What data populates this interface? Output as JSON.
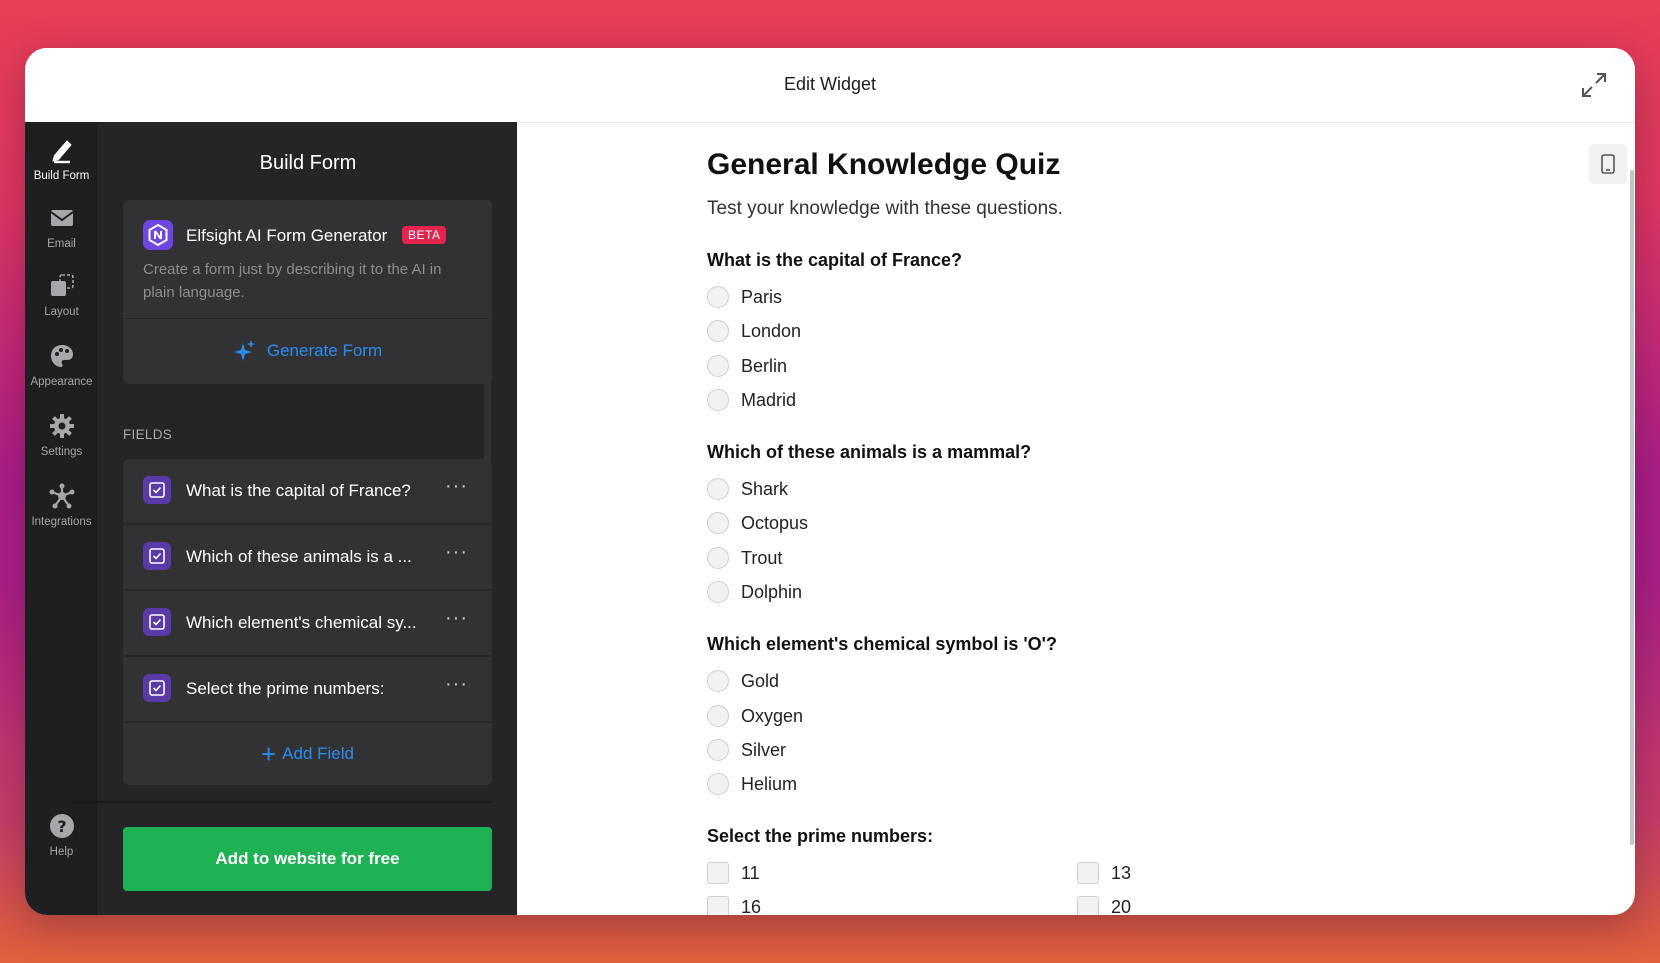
{
  "window": {
    "title": "Edit Widget"
  },
  "rail": {
    "items": [
      {
        "label": "Build Form",
        "icon": "pencil-icon",
        "active": true
      },
      {
        "label": "Email",
        "icon": "envelope-icon"
      },
      {
        "label": "Layout",
        "icon": "layout-icon"
      },
      {
        "label": "Appearance",
        "icon": "palette-icon"
      },
      {
        "label": "Settings",
        "icon": "gear-icon"
      },
      {
        "label": "Integrations",
        "icon": "integrations-icon"
      }
    ],
    "help_label": "Help"
  },
  "panel": {
    "title": "Build Form",
    "ai": {
      "title": "Elfsight AI Form Generator",
      "badge": "BETA",
      "description": "Create a form just by describing it to the AI in plain language.",
      "button": "Generate Form"
    },
    "fields_label": "FIELDS",
    "fields": [
      {
        "label": "What is the capital of France?"
      },
      {
        "label": "Which of these animals is a ..."
      },
      {
        "label": "Which element's chemical sy..."
      },
      {
        "label": "Select the prime numbers:"
      }
    ],
    "add_field": "Add Field",
    "cta": "Add to website for free"
  },
  "preview": {
    "title": "General Knowledge Quiz",
    "description": "Test your knowledge with these questions.",
    "questions": [
      {
        "text": "What is the capital of France?",
        "options": [
          "Paris",
          "London",
          "Berlin",
          "Madrid"
        ]
      },
      {
        "text": "Which of these animals is a mammal?",
        "options": [
          "Shark",
          "Octopus",
          "Trout",
          "Dolphin"
        ]
      },
      {
        "text": "Which element's chemical symbol is 'O'?",
        "options": [
          "Gold",
          "Oxygen",
          "Silver",
          "Helium"
        ]
      },
      {
        "text": "Select the prime numbers:",
        "options": [
          "11",
          "13",
          "16",
          "20"
        ]
      }
    ]
  },
  "colors": {
    "accent_blue": "#2b8cf0",
    "cta_green": "#1fb255",
    "beta_red": "#e5244d",
    "field_purple": "#5a3aa6"
  }
}
